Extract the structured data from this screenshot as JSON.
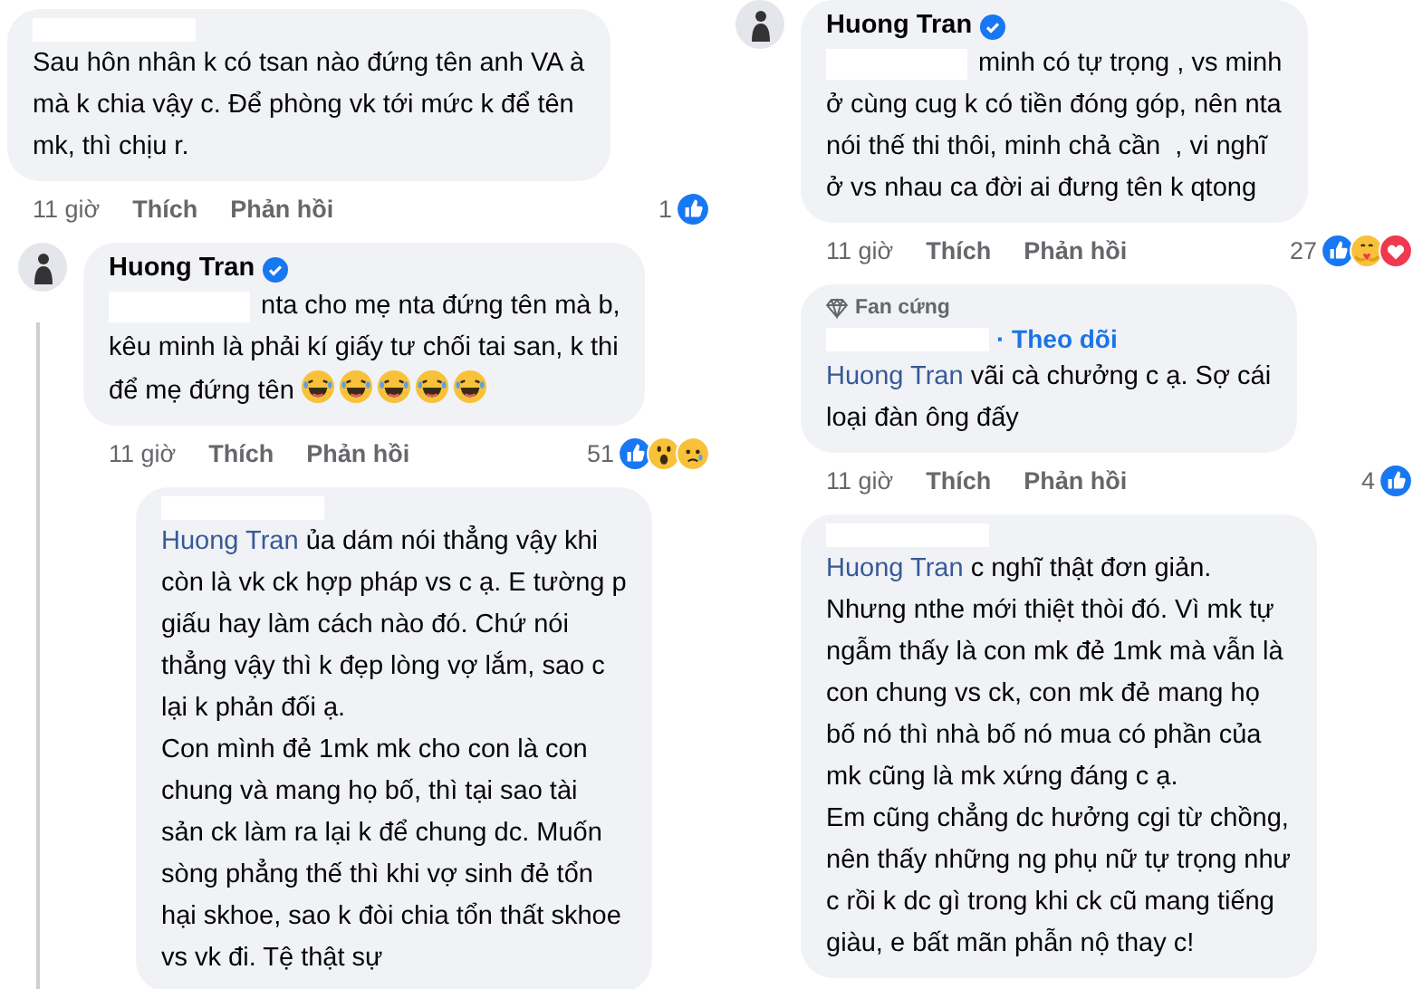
{
  "columns": [
    {
      "comments": [
        {
          "kind": "top",
          "redacted_name": true,
          "text": "Sau hôn nhân k có tsan nào đứng tên anh VA à\nmà k chia vậy c. Để phòng vk tới mức k để tên\nmk, thì chịu r.",
          "time": "11 giờ",
          "like": "Thích",
          "reply": "Phản hồi",
          "count": "1",
          "reactions": [
            {
              "kind": "like"
            }
          ]
        },
        {
          "kind": "comment",
          "avatar": true,
          "author": "Huong Tran",
          "verified": true,
          "redacted_prefix": true,
          "first_line": "nta cho mẹ nta đứng tên mà b,",
          "text": "kêu minh là phải kí giấy tư chối tai san, k thi\nđể mẹ đứng tên ",
          "emojis": [
            {
              "kind": "laugh"
            },
            {
              "kind": "laugh"
            },
            {
              "kind": "laugh"
            },
            {
              "kind": "laugh"
            },
            {
              "kind": "laugh"
            }
          ],
          "time": "11 giờ",
          "like": "Thích",
          "reply": "Phản hồi",
          "count": "51",
          "reactions": [
            {
              "kind": "like"
            },
            {
              "kind": "wow"
            },
            {
              "kind": "sad"
            }
          ]
        },
        {
          "kind": "nested",
          "redacted_name": true,
          "mention": "Huong Tran",
          "text": "ủa dám nói thẳng vậy khi\ncòn là vk ck hợp pháp vs c ạ. E tường p\ngiấu hay làm cách nào đó. Chứ nói\nthẳng vậy thì k đẹp lòng vợ lắm, sao c\nlại k phản đối ạ.\nCon mình đẻ 1mk mk cho con là con\nchung và mang họ bố, thì tại sao tài\nsản ck làm ra lại k để chung dc. Muốn\nsòng phẳng thế thì khi vợ sinh đẻ tổn\nhại skhoe, sao k đòi chia tổn thất skhoe\nvs vk đi. Tệ thật sự"
        }
      ]
    },
    {
      "comments": [
        {
          "kind": "comment",
          "avatar": true,
          "author": "Huong Tran",
          "verified": true,
          "redacted_prefix": true,
          "first_line": "minh có tự trọng , vs minh",
          "text": "ở cùng cug k có tiền đóng góp, nên nta\nnói thế thi thôi, minh chả cần  , vi nghĩ\nở vs nhau ca đời ai đưng tên k qtong",
          "time": "11 giờ",
          "like": "Thích",
          "reply": "Phản hồi",
          "count": "27",
          "reactions": [
            {
              "kind": "like"
            },
            {
              "kind": "care"
            },
            {
              "kind": "love"
            }
          ]
        },
        {
          "kind": "reply",
          "badge": "Fan cứng",
          "redacted_name": true,
          "follow": "· Theo dõi",
          "mention": "Huong Tran",
          "text": "vãi cà chưởng c ạ. Sợ cái\nloại đàn ông đấy",
          "time": "11 giờ",
          "like": "Thích",
          "reply": "Phản hồi",
          "count": "4",
          "reactions": [
            {
              "kind": "like"
            }
          ]
        },
        {
          "kind": "reply",
          "redacted_name": true,
          "mention": "Huong Tran",
          "text": "c nghĩ thật đơn giản.\nNhưng nthe mới thiệt thòi đó. Vì mk tự\nngẫm thấy là con mk đẻ 1mk mà vẫn là\ncon chung vs ck, con mk đẻ mang họ\nbố nó thì nhà bố nó mua có phần của\nmk cũng là mk xứng đáng c ạ.\nEm cũng chẳng dc hưởng cgi từ chồng,\nnên thấy những ng phụ nữ tự trọng như\nc rồi k dc gì trong khi ck cũ mang tiếng\ngiàu, e bất mãn phẫn nộ thay c!"
        }
      ]
    }
  ]
}
